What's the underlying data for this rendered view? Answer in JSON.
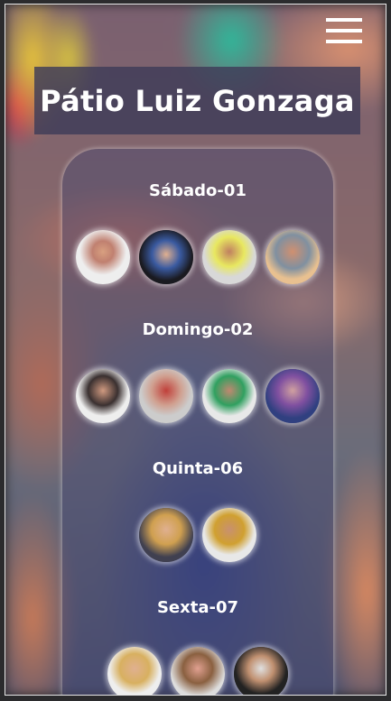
{
  "header": {
    "title": "Pátio Luiz Gonzaga",
    "menu_icon": "hamburger-menu-icon"
  },
  "schedule": [
    {
      "label": "Sábado-01",
      "avatars": [
        "radial-gradient(circle at 50% 40%,#d8a080 0,#c08070 25%,#eee 55%)",
        "radial-gradient(circle at 50% 45%,#e0b090 0,#3a5aa0 35%,#1a1a20 65%)",
        "radial-gradient(circle at 50% 40%,#c08060 0,#e8e860 35%,#d8d8d8 60%)",
        "radial-gradient(circle at 50% 40%,#d09070 0,#8090a0 40%,#e8c090 65%)"
      ]
    },
    {
      "label": "Domingo-02",
      "avatars": [
        "radial-gradient(circle at 50% 40%,#d09a80 0,#3a3030 35%,#eee 60%)",
        "radial-gradient(circle at 50% 40%,#c0403a 0,#d0a090 35%,#ccc 60%)",
        "radial-gradient(circle at 50% 40%,#c08870 0,#30a060 35%,#e8e8e8 60%)",
        "radial-gradient(circle at 50% 40%,#d0a0a0 0,#8050a0 35%,#304080 65%)"
      ]
    },
    {
      "label": "Quinta-06",
      "avatars": [
        "radial-gradient(circle at 50% 40%,#e0b090 0,#d0a050 35%,#404050 65%)",
        "radial-gradient(circle at 50% 40%,#c89070 0,#d0a030 35%,#e8e8e8 60%)"
      ]
    },
    {
      "label": "Sexta-07",
      "avatars": [
        "radial-gradient(circle at 50% 40%,#e0b090 0,#d8b060 35%,#eee 60%)",
        "radial-gradient(circle at 50% 40%,#e0a090 0,#8a6040 35%,#ddd 65%)",
        "radial-gradient(circle at 50% 40%,#e0e0e0 0,#c09070 30%,#222 60%)"
      ]
    }
  ]
}
